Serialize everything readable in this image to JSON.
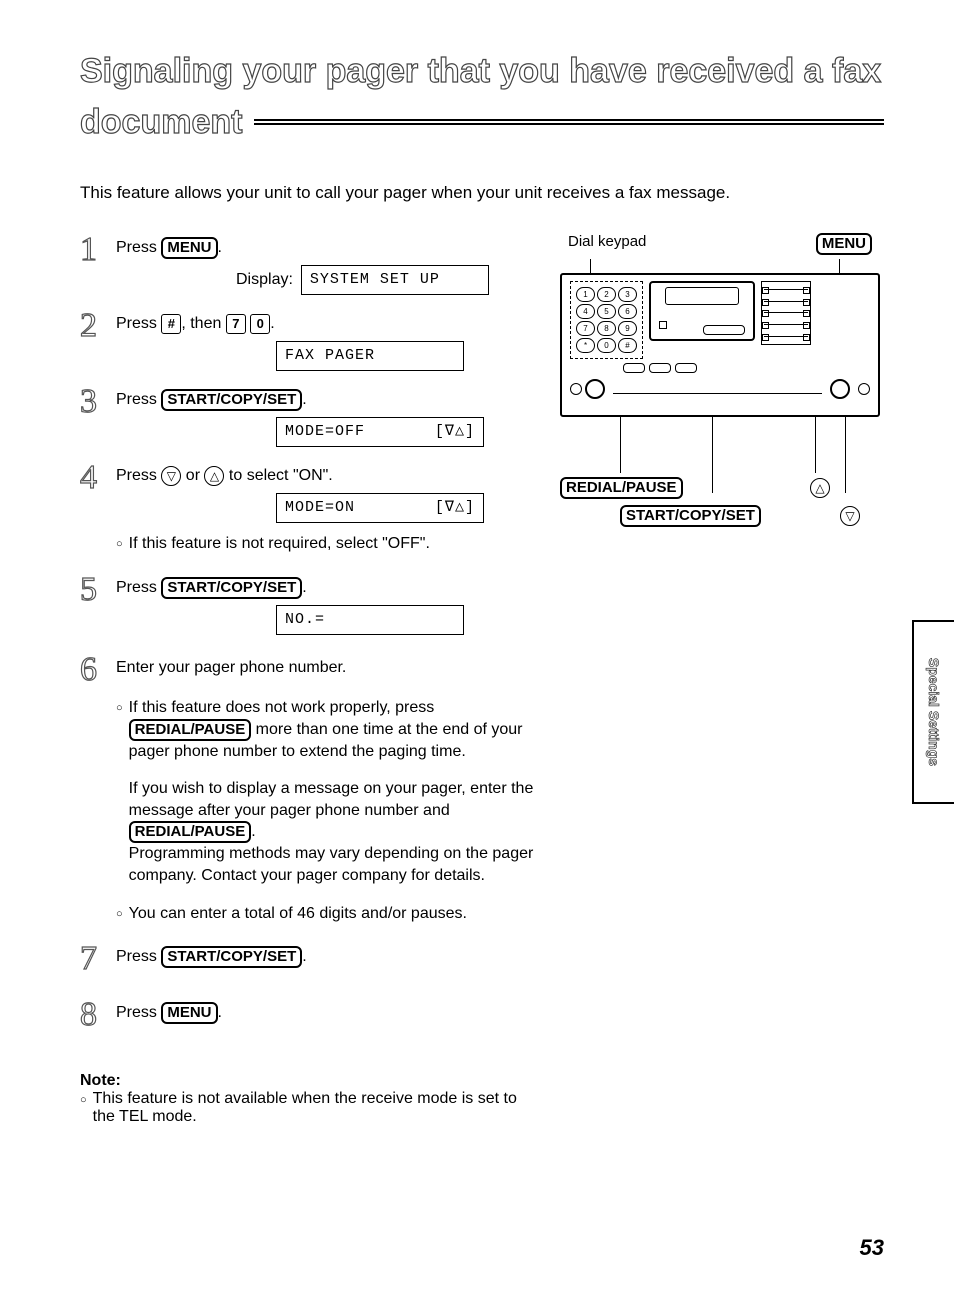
{
  "title_line1": "Signaling your pager that you have received a fax",
  "title_line2": "document",
  "intro": "This feature allows your unit to call your pager when your unit receives a fax message.",
  "steps": {
    "s1": {
      "num": "1",
      "pre": "Press ",
      "key": "MENU",
      "post": ".",
      "display_label": "Display:",
      "display": "SYSTEM SET UP"
    },
    "s2": {
      "num": "2",
      "pre": "Press ",
      "k1": "#",
      "mid": ", then ",
      "k2": "7",
      "k3": "0",
      "post": ".",
      "display": "FAX PAGER"
    },
    "s3": {
      "num": "3",
      "pre": "Press ",
      "key": "START/COPY/SET",
      "post": ".",
      "display": "MODE=OFF",
      "display_sym": "[∇△]"
    },
    "s4": {
      "num": "4",
      "pre": "Press ",
      "sym1": "▽",
      "mid": " or ",
      "sym2": "△",
      "post": " to select \"ON\".",
      "display": "MODE=ON",
      "display_sym": "[∇△]",
      "bullet": "If this feature is not required, select \"OFF\"."
    },
    "s5": {
      "num": "5",
      "pre": "Press ",
      "key": "START/COPY/SET",
      "post": ".",
      "display": "NO.="
    },
    "s6": {
      "num": "6",
      "text": "Enter your pager phone number.",
      "b1a": "If this feature does not work properly, press ",
      "b1key": "REDIAL/PAUSE",
      "b1b": " more than one time at the end of your pager phone number to extend the paging time.",
      "b2a": "If you wish to display a message on your pager, enter the message after your pager phone number and ",
      "b2key": "REDIAL/PAUSE",
      "b2b": ".\nProgramming methods may vary depending on the pager company. Contact your pager company for details.",
      "b3": "You can enter a total of 46 digits and/or pauses."
    },
    "s7": {
      "num": "7",
      "pre": "Press ",
      "key": "START/COPY/SET",
      "post": "."
    },
    "s8": {
      "num": "8",
      "pre": "Press ",
      "key": "MENU",
      "post": "."
    }
  },
  "note": {
    "heading": "Note:",
    "text": "This feature is not available when the receive mode is set to the TEL mode."
  },
  "diagram": {
    "top_left": "Dial keypad",
    "top_right": "MENU",
    "bottom1": "REDIAL/PAUSE",
    "bottom2": "START/COPY/SET",
    "sym_up": "△",
    "sym_down": "▽"
  },
  "side_tab": "Special Settings",
  "page_number": "53"
}
